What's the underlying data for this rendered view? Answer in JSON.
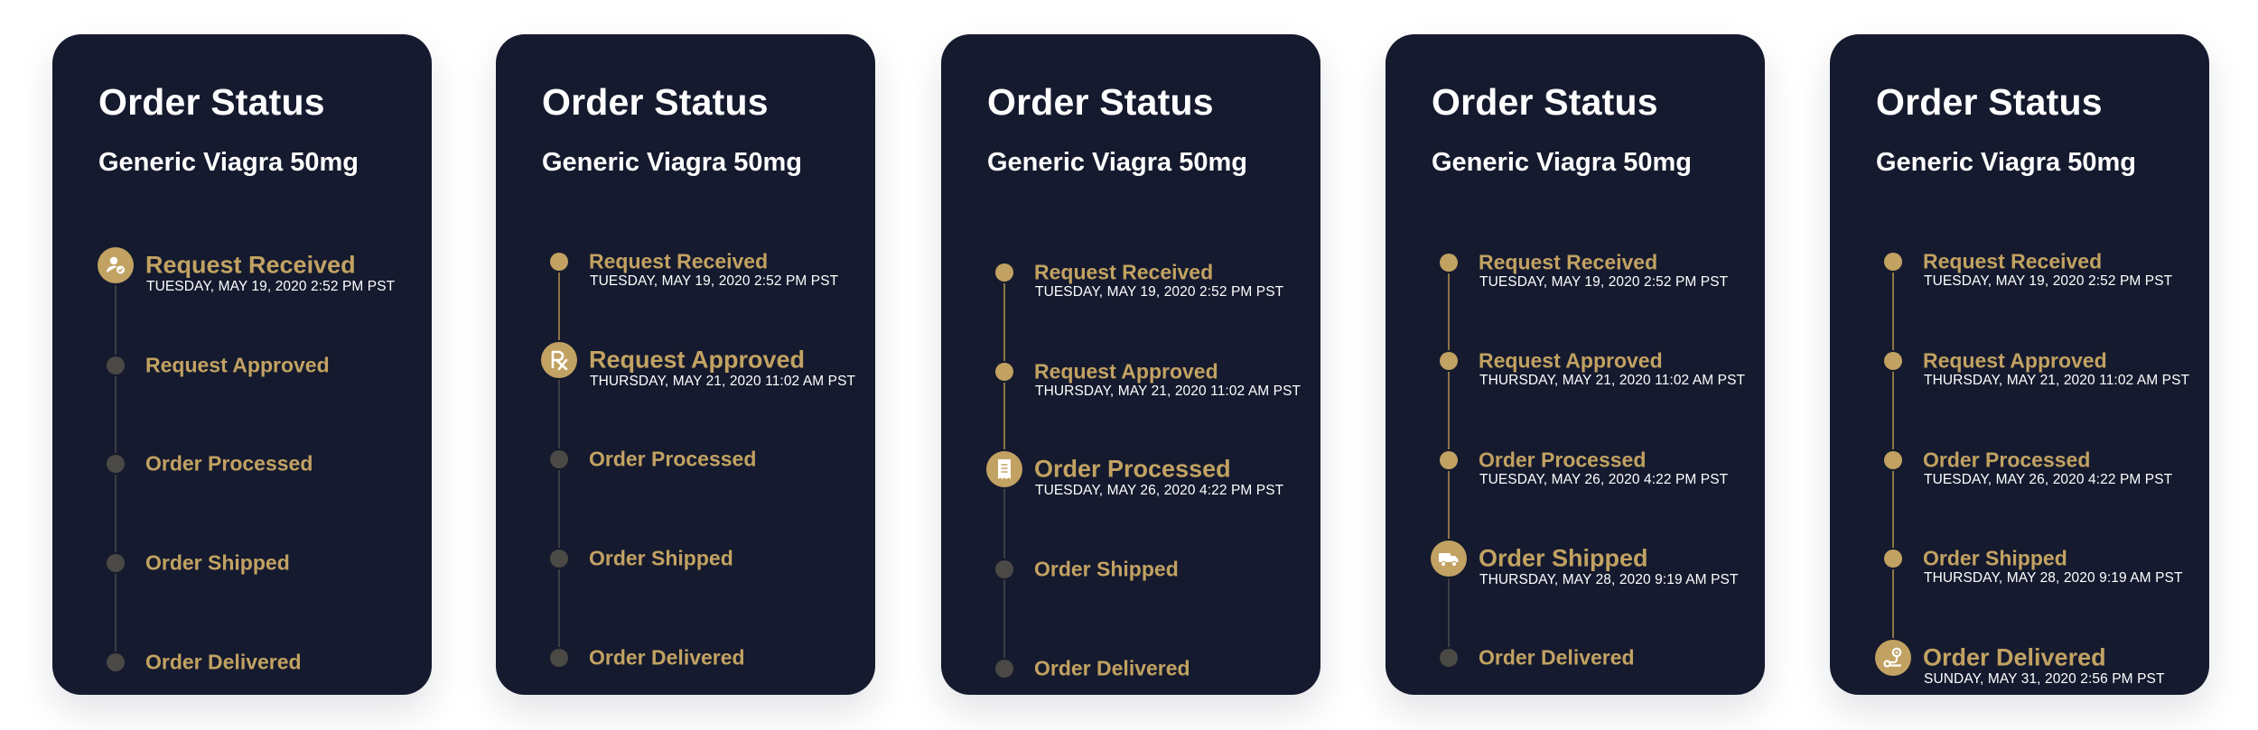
{
  "colors": {
    "card_background": "#151a2e",
    "accent_gold": "#c2a262",
    "pending_dot": "#4a4945",
    "page_background": "#ffffff"
  },
  "cards": [
    {
      "title": "Order Status",
      "product": "Generic Viagra 50mg",
      "steps": [
        {
          "label": "Request Received",
          "date": "TUESDAY, MAY 19, 2020 2:52 PM PST"
        },
        {
          "label": "Request Approved",
          "date": ""
        },
        {
          "label": "Order Processed",
          "date": ""
        },
        {
          "label": "Order Shipped",
          "date": ""
        },
        {
          "label": "Order Delivered",
          "date": ""
        }
      ],
      "current_step_icon": "user-check-icon"
    },
    {
      "title": "Order Status",
      "product": "Generic Viagra 50mg",
      "steps": [
        {
          "label": "Request Received",
          "date": "TUESDAY, MAY 19, 2020 2:52 PM PST"
        },
        {
          "label": "Request Approved",
          "date": "THURSDAY, MAY 21, 2020 11:02 AM PST"
        },
        {
          "label": "Order Processed",
          "date": ""
        },
        {
          "label": "Order Shipped",
          "date": ""
        },
        {
          "label": "Order Delivered",
          "date": ""
        }
      ],
      "current_step_icon": "prescription-rx-icon"
    },
    {
      "title": "Order Status",
      "product": "Generic Viagra 50mg",
      "steps": [
        {
          "label": "Request Received",
          "date": "TUESDAY, MAY 19, 2020 2:52 PM PST"
        },
        {
          "label": "Request Approved",
          "date": "THURSDAY, MAY 21, 2020 11:02 AM PST"
        },
        {
          "label": "Order Processed",
          "date": "TUESDAY, MAY 26, 2020 4:22 PM PST"
        },
        {
          "label": "Order Shipped",
          "date": ""
        },
        {
          "label": "Order Delivered",
          "date": ""
        }
      ],
      "current_step_icon": "receipt-icon"
    },
    {
      "title": "Order Status",
      "product": "Generic Viagra 50mg",
      "steps": [
        {
          "label": "Request Received",
          "date": "TUESDAY, MAY 19, 2020 2:52 PM PST"
        },
        {
          "label": "Request Approved",
          "date": "THURSDAY, MAY 21, 2020 11:02 AM PST"
        },
        {
          "label": "Order Processed",
          "date": "TUESDAY, MAY 26, 2020 4:22 PM PST"
        },
        {
          "label": "Order Shipped",
          "date": "THURSDAY, MAY 28, 2020 9:19 AM PST"
        },
        {
          "label": "Order Delivered",
          "date": ""
        }
      ],
      "current_step_icon": "delivery-truck-icon"
    },
    {
      "title": "Order Status",
      "product": "Generic Viagra 50mg",
      "steps": [
        {
          "label": "Request Received",
          "date": "TUESDAY, MAY 19, 2020 2:52 PM PST"
        },
        {
          "label": "Request Approved",
          "date": "THURSDAY, MAY 21, 2020 11:02 AM PST"
        },
        {
          "label": "Order Processed",
          "date": "TUESDAY, MAY 26, 2020 4:22 PM PST"
        },
        {
          "label": "Order Shipped",
          "date": "THURSDAY, MAY 28, 2020 9:19 AM PST"
        },
        {
          "label": "Order Delivered",
          "date": "SUNDAY, MAY 31, 2020 2:56 PM PST"
        }
      ],
      "current_step_icon": "route-pin-icon"
    }
  ]
}
